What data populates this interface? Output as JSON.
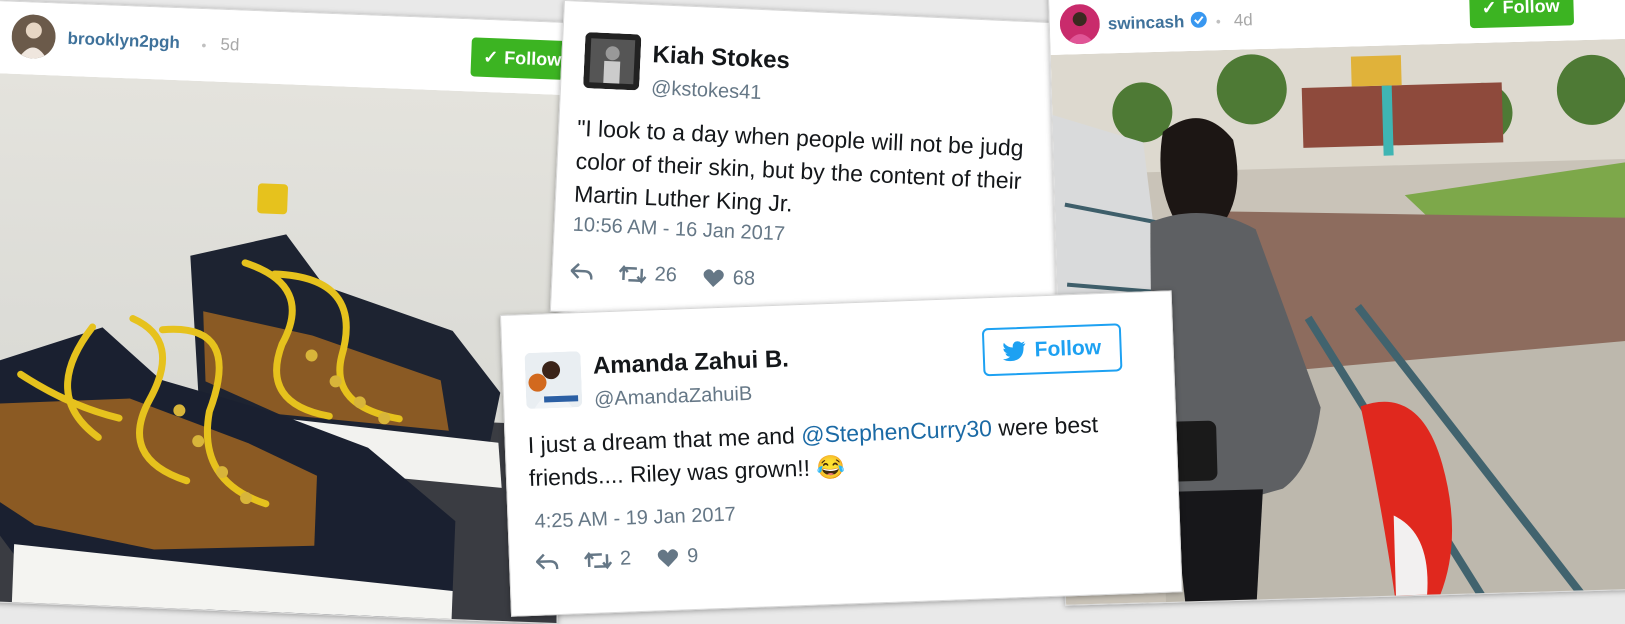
{
  "ig_left": {
    "username": "brooklyn2pgh",
    "dot": "•",
    "age": "5d",
    "follow_label": "Follow",
    "photo_desc_icon": "sneakers-photo"
  },
  "tweet_kiah": {
    "name": "Kiah Stokes",
    "handle": "@kstokes41",
    "text_lines": [
      "\"I look to a day when people will not be judg",
      "color of their skin, but by the content of their",
      "Martin Luther King Jr."
    ],
    "timestamp": "10:56 AM - 16 Jan 2017",
    "retweets": "26",
    "likes": "68"
  },
  "tweet_amanda": {
    "name": "Amanda Zahui B.",
    "handle": "@AmandaZahuiB",
    "follow_label": "Follow",
    "text_line1_pre": "I just a dream that me and ",
    "text_line1_mention": "@StephenCurry30",
    "text_line1_post": " were best",
    "text_line2": "friends.... Riley was grown!! 😂",
    "timestamp": "4:25 AM - 19 Jan 2017",
    "retweets": "2",
    "likes": "9"
  },
  "ig_right": {
    "username": "swincash",
    "dot": "•",
    "age": "4d",
    "follow_label": "Follow"
  },
  "colors": {
    "instagram_blue": "#3f729b",
    "instagram_green": "#3cb422",
    "twitter_blue": "#1da1f2",
    "mention_blue": "#1b6aa5"
  }
}
